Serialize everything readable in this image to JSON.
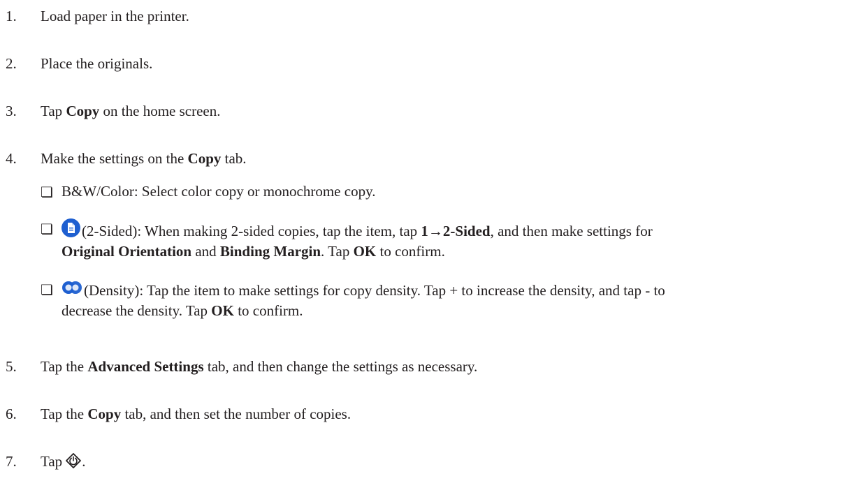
{
  "steps": [
    {
      "num": "1.",
      "text": "Load paper in the printer."
    },
    {
      "num": "2.",
      "text": "Place the originals."
    },
    {
      "num": "3.",
      "pre": "Tap ",
      "bold": "Copy",
      "post": " on the home screen."
    },
    {
      "num": "4.",
      "pre": "Make the settings on the ",
      "bold": "Copy",
      "post": " tab."
    },
    {
      "num": "5.",
      "pre": "Tap the ",
      "bold": "Advanced Settings",
      "post": " tab, and then change the settings as necessary."
    },
    {
      "num": "6.",
      "pre": "Tap the ",
      "bold": "Copy",
      "post": " tab, and then set the number of copies."
    },
    {
      "num": "7.",
      "pre": "Tap",
      "post": "."
    }
  ],
  "checkbox_glyph": "❏",
  "sub_items": {
    "bw_color": "B&W/Color: Select color copy or monochrome copy.",
    "two_sided": {
      "icon": "two-sided-icon",
      "t1": "(2-Sided): When making 2-sided copies, tap the item, tap ",
      "b1": "1→2-Sided",
      "t2": ", and then make settings for",
      "b2": "Original Orientation",
      "t3": " and ",
      "b3": "Binding Margin",
      "t4": ". Tap ",
      "b4": "OK",
      "t5": " to confirm."
    },
    "density": {
      "icon": "density-icon",
      "t1": "(Density): Tap the item to make settings for copy density. Tap + to increase the density, and tap - to",
      "t2": "decrease the density. Tap ",
      "b1": "OK",
      "t3": " to confirm."
    }
  },
  "start_icon": "start-button-icon",
  "colors": {
    "text": "#231f20",
    "icon_blue": "#1e5fd0"
  }
}
